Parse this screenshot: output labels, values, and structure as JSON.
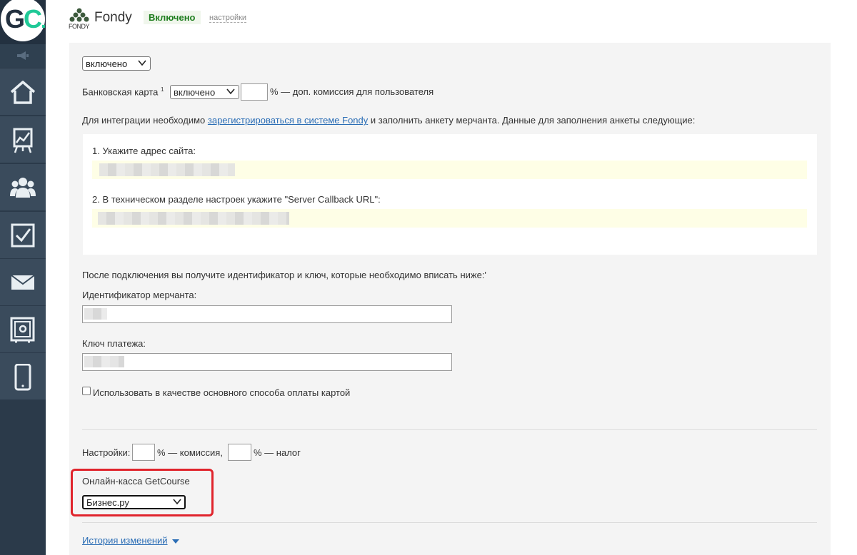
{
  "sidebar": {
    "logo_text": "GC",
    "logo_accent": "C",
    "items": [
      {
        "name": "home-icon"
      },
      {
        "name": "chart-board-icon"
      },
      {
        "name": "users-icon"
      },
      {
        "name": "checkbox-icon"
      },
      {
        "name": "mail-icon"
      },
      {
        "name": "safe-icon"
      },
      {
        "name": "mobile-icon"
      }
    ]
  },
  "header": {
    "logo_word": "FONDY",
    "title": "Fondy",
    "status": "Включено",
    "settings_link": "настройки"
  },
  "panel": {
    "main_select": {
      "value": "включено"
    },
    "bank_card": {
      "label": "Банковская карта",
      "sup": "1",
      "select_value": "включено",
      "commission_text": "% — доп. комиссия для пользователя"
    },
    "integration": {
      "text_before": "Для интеграции необходимо ",
      "link": "зарегистрироваться в системе Fondy",
      "text_after": " и заполнить анкету мерчанта. Данные для заполнения анкеты следующие:"
    },
    "step1": "1. Укажите адрес сайта:",
    "step2": "2. В техническом разделе настроек укажите \"Server Callback URL\":",
    "after_connect": "После подключения вы получите идентификатор и ключ, которые необходимо вписать ниже:'",
    "merchant_id_label": "Идентификатор мерчанта:",
    "payment_key_label": "Ключ платежа:",
    "default_checkbox_label": "Использовать в качестве основного способа оплаты картой",
    "settings": {
      "label": "Настройки:",
      "commission_text": "% — комиссия,",
      "tax_text": "% — налог"
    },
    "online_kassa": {
      "label": "Онлайн-касса GetCourse",
      "select_value": "Бизнес.ру"
    },
    "history_link": "История изменений"
  },
  "colors": {
    "sidebar_bg": "#2b3a4a",
    "nav_item_bg": "#3a4b5c",
    "accent": "#20c997",
    "link": "#2a6db5",
    "status_green": "#1e7d1e",
    "highlight_red": "#e0242c",
    "yellow_field": "#fefee6"
  }
}
